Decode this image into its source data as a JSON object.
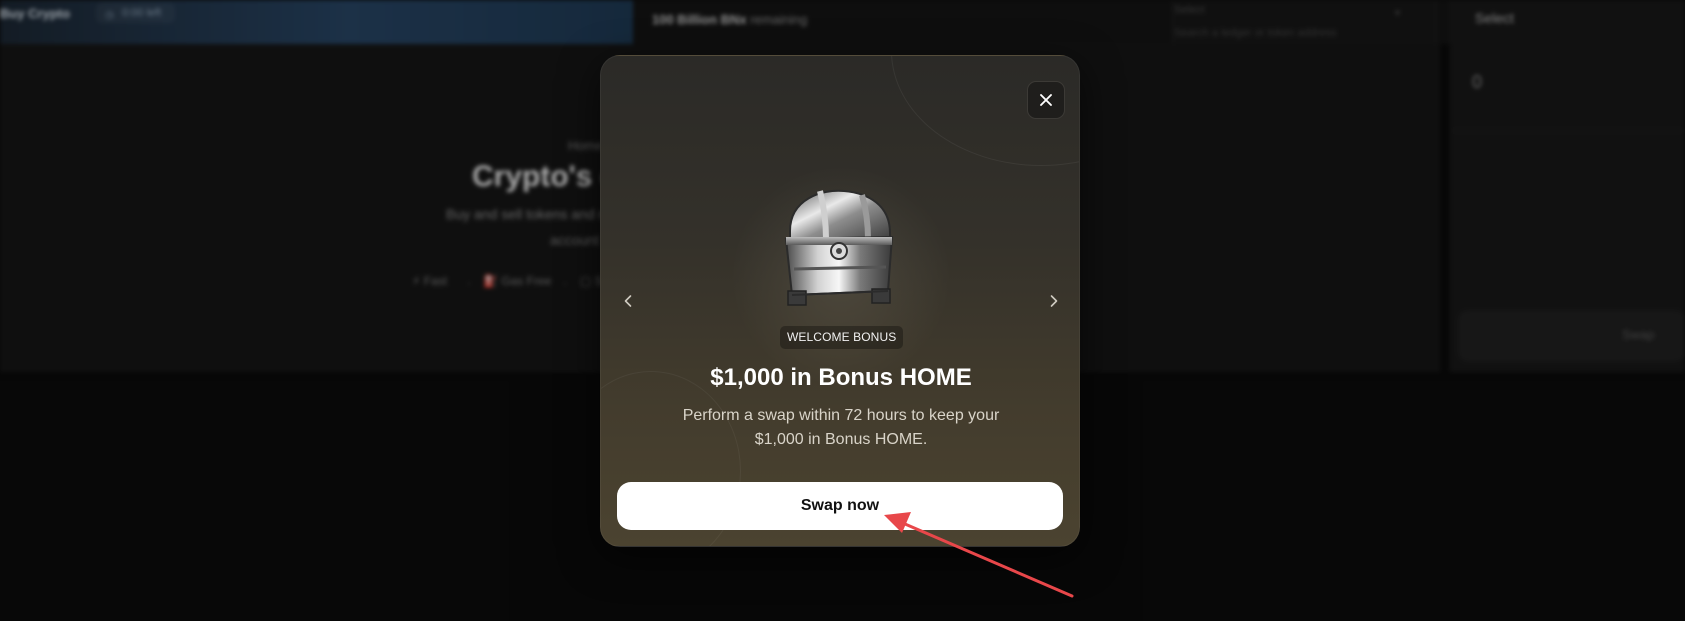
{
  "background": {
    "banner_label": "Buy Crypto",
    "banner_pill": "0:00 left",
    "remaining_text": "remaining",
    "remaining_value": "100 Billion BNx",
    "search_label": "Select",
    "search_hint": "Search a ledger or token address",
    "hero_small": "Home",
    "hero_headline": "Crypto's own",
    "hero_sub1": "Buy and sell tokens and manage your",
    "hero_sub2": "account",
    "features": [
      "Fast",
      "Gas Free",
      "Self"
    ],
    "right_select": "Select",
    "right_amount": "0",
    "right_swap": "Swap"
  },
  "modal": {
    "badge": "WELCOME BONUS",
    "title": "$1,000 in Bonus HOME",
    "description": "Perform a swap within 72 hours to keep your $1,000 in Bonus HOME.",
    "cta_label": "Swap now"
  },
  "icons": {
    "close": "close-icon",
    "prev": "chevron-left-icon",
    "next": "chevron-right-icon",
    "image": "treasure-chest-icon"
  },
  "colors": {
    "modal_top": "#2b2a27",
    "modal_bottom": "#4b4330",
    "cta_bg": "#ffffff",
    "annotation": "#e8474a"
  }
}
